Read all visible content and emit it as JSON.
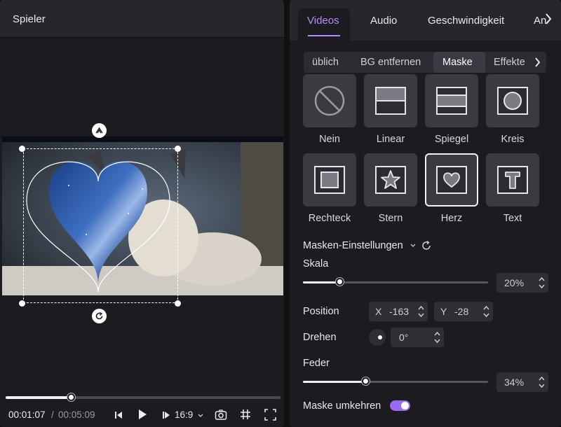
{
  "player": {
    "title": "Spieler",
    "time_current": "00:01:07",
    "time_separator": "/",
    "time_total": "00:05:09",
    "progress": 0.24,
    "aspect_ratio": "16:9"
  },
  "panel": {
    "tabs": [
      {
        "label": "Videos",
        "active": true
      },
      {
        "label": "Audio"
      },
      {
        "label": "Geschwindigkeit"
      },
      {
        "label": "An"
      }
    ],
    "subtabs": [
      {
        "label": "üblich"
      },
      {
        "label": "BG entfernen"
      },
      {
        "label": "Maske",
        "active": true
      },
      {
        "label": "Effekte"
      }
    ],
    "masks": [
      {
        "label": "Nein",
        "icon": "none-icon"
      },
      {
        "label": "Linear",
        "icon": "linear-icon"
      },
      {
        "label": "Spiegel",
        "icon": "mirror-icon"
      },
      {
        "label": "Kreis",
        "icon": "circle-icon"
      },
      {
        "label": "Rechteck",
        "icon": "rectangle-icon"
      },
      {
        "label": "Stern",
        "icon": "star-icon"
      },
      {
        "label": "Herz",
        "icon": "heart-icon",
        "selected": true
      },
      {
        "label": "Text",
        "icon": "text-icon"
      }
    ],
    "settings": {
      "title": "Masken-Einstellungen",
      "scale_label": "Skala",
      "scale_value": "20%",
      "scale_fraction": 0.2,
      "position_label": "Position",
      "x_label": "X",
      "x_value": "-163",
      "y_label": "Y",
      "y_value": "-28",
      "rotate_label": "Drehen",
      "rotate_value": "0°",
      "feather_label": "Feder",
      "feather_value": "34%",
      "feather_fraction": 0.34,
      "invert_label": "Maske umkehren",
      "invert_on": true
    }
  },
  "colors": {
    "accent": "#b48cff",
    "toggle": "#9a6bf0"
  }
}
